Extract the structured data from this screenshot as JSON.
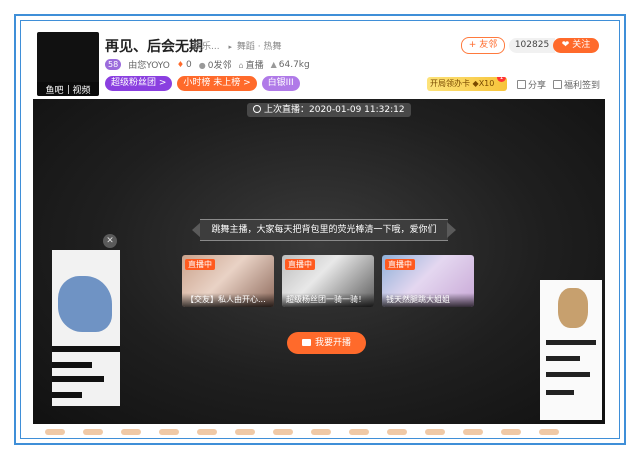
{
  "header": {
    "title": "再见、后会无期",
    "category": "娱乐...",
    "subcategory": "舞蹈",
    "subcategory2": "热舞",
    "level": "58",
    "owner": "由您YOYO",
    "heat": "0",
    "friends": "0发邻",
    "live_label": "直播",
    "weight": "64.7kg",
    "avatar_footer_left": "鱼吧",
    "avatar_footer_right": "视频",
    "tags": [
      "超级粉丝团 >",
      "小时榜 未上榜 >",
      "白银III"
    ],
    "friend_button": "+ 友邻",
    "follower_count": "102825",
    "follow_button": "❤ 关注",
    "card_button": "开局领办卡 ◆X10",
    "card_badge": "1",
    "share_label": "分享",
    "welfare_label": "福利签到"
  },
  "player": {
    "last_live": "上次直播：2020-01-09 11:32:12",
    "banner_text": "跳舞主播，大家每天把背包里的荧光棒清一下哦，爱你们",
    "recommendations": [
      {
        "badge": "直播中",
        "caption": "【交友】私人由开心..."
      },
      {
        "badge": "直播中",
        "caption": "超级杨丝团一骑一骑！"
      },
      {
        "badge": "直播中",
        "caption": "钱天然腿跳大姐姐"
      }
    ],
    "go_live_button": "我要开播",
    "close_symbol": "✕",
    "right_close_symbol": "✕"
  },
  "colors": {
    "accent": "#ff6a2b",
    "purple": "#8a3fe0",
    "frame": "#3f8fd8"
  }
}
